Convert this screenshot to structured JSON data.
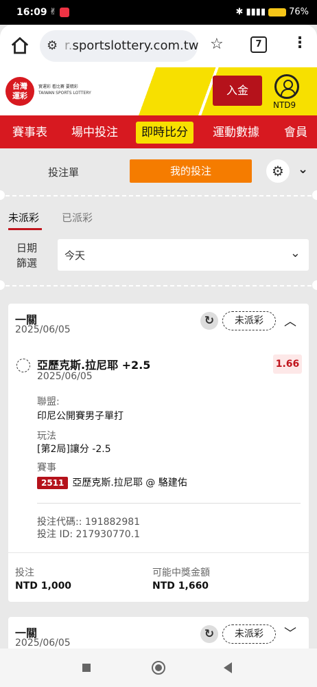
{
  "status_bar": {
    "time": "16:09",
    "battery": "76"
  },
  "browser": {
    "url_dim": "r.",
    "url": "sportslottery.com.tw",
    "tab_count": "7"
  },
  "header": {
    "logo_line1": "台灣",
    "logo_line2": "運彩",
    "tagline1": "實運彩  看比賽  要精彩",
    "tagline2": "TAIWAN SPORTS LOTTERY",
    "deposit": "入金",
    "balance": "NTD9"
  },
  "nav": {
    "items": [
      "賽事表",
      "場中投注",
      "即時比分",
      "運動數據",
      "會員"
    ]
  },
  "betslip": {
    "tab_slip": "投注單",
    "tab_mybets": "我的投注"
  },
  "filter": {
    "tab_unsettled": "未派彩",
    "tab_settled": "已派彩",
    "date_label_1": "日期",
    "date_label_2": "篩選",
    "date_value": "今天"
  },
  "cards": [
    {
      "title": "一關",
      "date": "2025/06/05",
      "status": "未派彩",
      "selection": "亞歷克斯.拉尼耶 +2.5",
      "selection_date": "2025/06/05",
      "odds": "1.66",
      "league_label": "聯盟:",
      "league": "印尼公開賽男子單打",
      "market_label": "玩法",
      "market": "[第2局]讓分 -2.5",
      "event_label": "賽事",
      "event_no": "2511",
      "event": "亞歷克斯.拉尼耶 @ 駱建佑",
      "bet_code": "投注代碼:: 191882981",
      "bet_id": "投注 ID: 217930770.1",
      "stake_label": "投注",
      "stake": "NTD 1,000",
      "payout_label": "可能中獎金額",
      "payout": "NTD 1,660"
    },
    {
      "title": "一關",
      "date": "2025/06/05",
      "status": "未派彩"
    }
  ]
}
